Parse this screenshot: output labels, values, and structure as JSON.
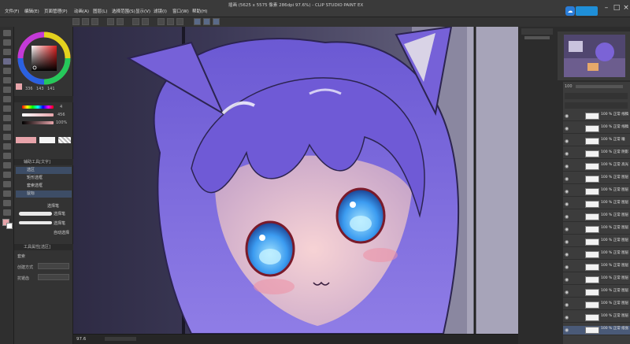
{
  "app": {
    "window_title": "插画 (5625 x 5575 像素 286dpi 97.6%) - CLIP STUDIO PAINT EX",
    "window_controls": {
      "minimize": "–",
      "maximize": "□",
      "close": "×"
    }
  },
  "menu": {
    "items": [
      "文件(F)",
      "编辑(E)",
      "页面管理(P)",
      "动画(A)",
      "图层(L)",
      "选择范围(S)",
      "显示(V)",
      "滤镜(I)",
      "窗口(W)",
      "帮助(H)"
    ]
  },
  "left_panel": {
    "color_values": {
      "h": "336",
      "s": "143",
      "v": "141"
    },
    "slider_readouts": [
      "4",
      "456",
      "100%"
    ],
    "subtool_header": "辅助工具[文字]",
    "subtools": [
      "选区",
      "矩形选框",
      "套索选框",
      "鼠标",
      "选择笔",
      "自动选择"
    ],
    "brush_names": [
      "选择笔",
      "选择笔",
      "选择笔",
      "喷枪选区"
    ],
    "tool_property_header": "工具属性[选区]",
    "tool_property_labels": [
      "套索",
      "抗锯齿",
      "创建方式"
    ]
  },
  "status": {
    "zoom": "97.6"
  },
  "layers": {
    "opacity": "100",
    "items": [
      {
        "name": "100 % 正常\n线稿",
        "selected": false
      },
      {
        "name": "100 % 正常\n线稿 19",
        "selected": false
      },
      {
        "name": "100 % 正常\n瞳",
        "selected": false
      },
      {
        "name": "100 % 正常\n阴影",
        "selected": false
      },
      {
        "name": "100 % 正常\n高光",
        "selected": false
      },
      {
        "name": "100 % 正常\n图层 17",
        "selected": false
      },
      {
        "name": "100 % 正常\n图层 16",
        "selected": false
      },
      {
        "name": "100 % 正常\n图层 15",
        "selected": false
      },
      {
        "name": "100 % 正常\n图层 14",
        "selected": false
      },
      {
        "name": "100 % 正常\n图层 13",
        "selected": false
      },
      {
        "name": "100 % 正常\n图层 12",
        "selected": false
      },
      {
        "name": "100 % 正常\n图层 11",
        "selected": false
      },
      {
        "name": "100 % 正常\n图层 10",
        "selected": false
      },
      {
        "name": "100 % 正常\n图层 9",
        "selected": false
      },
      {
        "name": "100 % 正常\n图层 8",
        "selected": false
      },
      {
        "name": "100 % 正常\n图层 7",
        "selected": false
      },
      {
        "name": "100 % 正常\n图层 6",
        "selected": false
      },
      {
        "name": "100 % 正常\n纸张",
        "selected": true
      }
    ]
  },
  "colors": {
    "accent": "#2a7dd9",
    "hair": "#7b63d6",
    "eye": "#3b9bf0",
    "skin": "#f0c9cc"
  }
}
